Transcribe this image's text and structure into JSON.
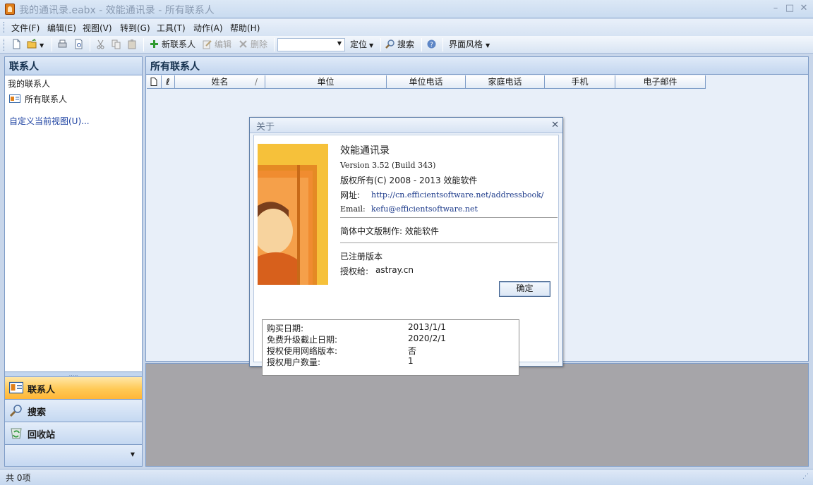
{
  "window": {
    "title": "我的通讯录.eabx - 效能通讯录 - 所有联系人"
  },
  "menu": [
    "文件(F)",
    "编辑(E)",
    "视图(V)",
    "转到(G)",
    "工具(T)",
    "动作(A)",
    "帮助(H)"
  ],
  "toolbar": {
    "new_contact": "新联系人",
    "edit": "编辑",
    "delete": "删除",
    "locate": "定位",
    "search": "搜索",
    "theme": "界面风格"
  },
  "left_pane": {
    "header": "联系人",
    "my_contacts": "我的联系人",
    "all_contacts": "所有联系人",
    "customize_view": "自定义当前视图(U)..."
  },
  "nav": {
    "contacts": "联系人",
    "search": "搜索",
    "recycle": "回收站"
  },
  "main": {
    "header": "所有联系人",
    "columns": [
      "姓名",
      "单位",
      "单位电话",
      "家庭电话",
      "手机",
      "电子邮件"
    ]
  },
  "status": {
    "text": "共 0项"
  },
  "about": {
    "title": "关于",
    "product": "效能通讯录",
    "version": "Version 3.52 (Build 343)",
    "copyright": "版权所有(C) 2008 - 2013 效能软件",
    "website_label": "网址:",
    "website": "http://cn.efficientsoftware.net/addressbook/",
    "email_label": "Email:",
    "email": "kefu@efficientsoftware.net",
    "localization": "简体中文版制作: 效能软件",
    "registered": "已注册版本",
    "licensed_to_label": "授权给:",
    "licensed_to": "astray.cn",
    "ok_button": "确定",
    "license_info": [
      {
        "label": "购买日期:",
        "value": "2013/1/1"
      },
      {
        "label": "免费升级截止日期:",
        "value": "2020/2/1"
      },
      {
        "label": "授权使用网络版本:",
        "value": "否"
      },
      {
        "label": "授权用户数量:",
        "value": "1"
      }
    ]
  },
  "colors": {
    "accent": "#ffc955",
    "pane_bg": "#e8eff9",
    "border": "#7e9cc7",
    "preview_bg": "#a6a5a9"
  }
}
